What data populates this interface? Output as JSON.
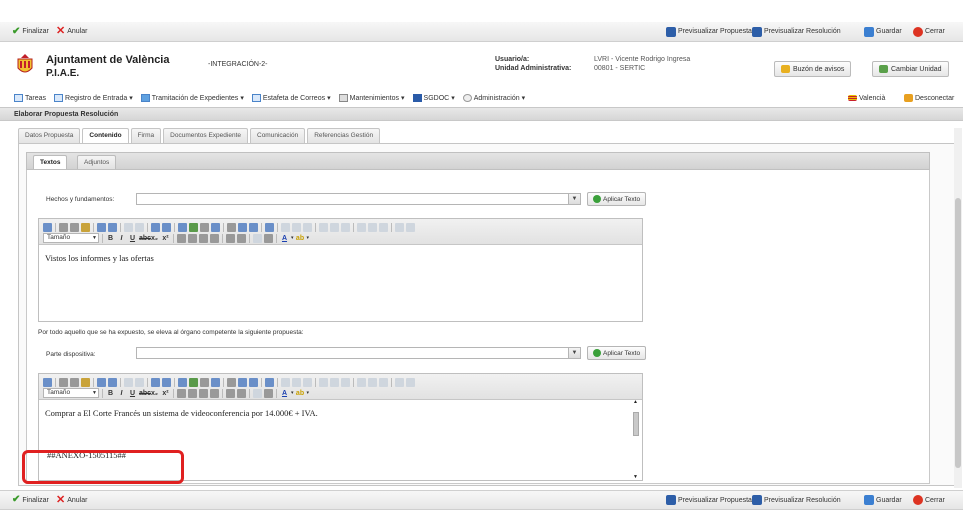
{
  "top_toolbar": {
    "finalize": "Finalizar",
    "cancel": "Anular",
    "preview_proposal": "Previsualizar Propuesta",
    "preview_resolution": "Previsualizar Resolución",
    "save": "Guardar",
    "close": "Cerrar"
  },
  "header": {
    "org_name": "Ajuntament de València",
    "app_name": "P.I.A.E.",
    "environment": "-INTEGRACIÓN-2-",
    "user_label": "Usuario/a:",
    "user_value": "LVRI - Vicente Rodrigo Ingresa",
    "unit_label": "Unidad Administrativa:",
    "unit_value": "00801 - SERTIC",
    "notices_button": "Buzón de avisos",
    "change_unit_button": "Cambiar Unidad"
  },
  "menubar": {
    "items": [
      "Tareas",
      "Registro de Entrada",
      "Tramitación de Expedientes",
      "Estafeta de Correos",
      "Mantenimientos",
      "SGDOC",
      "Administración"
    ],
    "language": "Valencià",
    "disconnect": "Desconectar"
  },
  "section_title": "Elaborar Propuesta Resolución",
  "tabs": [
    "Datos Propuesta",
    "Contenido",
    "Firma",
    "Documentos Expediente",
    "Comunicación",
    "Referencias Gestión"
  ],
  "active_tab": "Contenido",
  "subtabs": [
    "Textos",
    "Adjuntos"
  ],
  "form": {
    "facts_label": "Hechos y fundamentos:",
    "facts_value": "",
    "apply_text": "Aplicar Texto",
    "editor1_size": "Tamaño",
    "editor1_text": "Vistos los informes y las ofertas",
    "proposal_intro": "Por todo aquello que se ha expuesto, se eleva al órgano competente la siguiente propuesta:",
    "dispositive_label": "Parte dispositiva:",
    "dispositive_value": "",
    "editor2_size": "Tamaño",
    "editor2_line1": "Comprar a El Corte Francés un sistema de videoconferencia por 14.000€ + IVA.",
    "editor2_line2": "##ANEXO-1505115##"
  },
  "colors": {
    "highlight_box": "#e02020",
    "toolbar_gradient_top": "#f7f7f7",
    "link_blue": "#2d5ea8"
  }
}
